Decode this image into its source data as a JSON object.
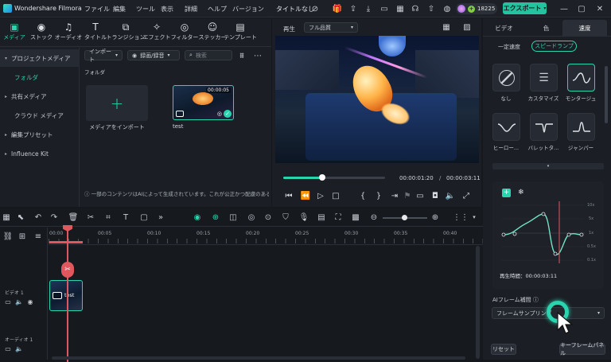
{
  "app": {
    "title": "Wondershare Filmora",
    "project_title": "タイトルなし",
    "credits": "18225",
    "export_label": "エクスポート"
  },
  "menu": [
    "ファイル",
    "編集",
    "ツール",
    "表示",
    "詳細",
    "ヘルプ",
    "バージョン"
  ],
  "toolbar_tabs": [
    {
      "label": "メディア",
      "icon": "media-icon"
    },
    {
      "label": "ストック",
      "icon": "stock-icon"
    },
    {
      "label": "オーディオ",
      "icon": "audio-icon"
    },
    {
      "label": "タイトル",
      "icon": "title-icon"
    },
    {
      "label": "トランジション",
      "icon": "transition-icon"
    },
    {
      "label": "エフェクト",
      "icon": "effect-icon"
    },
    {
      "label": "フィルター",
      "icon": "filter-icon"
    },
    {
      "label": "ステッカー",
      "icon": "sticker-icon"
    },
    {
      "label": "テンプレート",
      "icon": "template-icon"
    }
  ],
  "sidebar": {
    "items": [
      {
        "label": "プロジェクトメディア",
        "arrow": "▾"
      },
      {
        "label": "フォルダ",
        "arrow": ""
      },
      {
        "label": "共有メディア",
        "arrow": "▸"
      },
      {
        "label": "クラウド メディア",
        "arrow": ""
      },
      {
        "label": "編集プリセット",
        "arrow": "▸"
      },
      {
        "label": "Influence Kit",
        "arrow": "▸"
      }
    ]
  },
  "media": {
    "import_label": "インポート",
    "record_label": "録画/録音",
    "search_placeholder": "検索",
    "folder_label": "フォルダ",
    "import_tile_label": "メディアをインポート",
    "clip_name": "test",
    "clip_duration": "00:00:05",
    "notice": "一部のコンテンツはAIによって生成されています。これが公正かつ配慮のある..."
  },
  "player": {
    "tab_label": "再生",
    "quality": "フル品質",
    "current_time": "00:00:01:20",
    "total_time": "00:00:03:11",
    "progress": 0.38
  },
  "right_panel": {
    "tabs": [
      "ビデオ",
      "色",
      "速度"
    ],
    "sub_tabs": [
      "一定速度",
      "スピードランプ"
    ],
    "presets": [
      {
        "label": "なし"
      },
      {
        "label": "カスタマイズ"
      },
      {
        "label": "モンタージュ"
      },
      {
        "label": "ヒーロー..."
      },
      {
        "label": "バレットタ..."
      },
      {
        "label": "ジャンパー"
      }
    ],
    "graph_y_labels": [
      "10x",
      "5x",
      "1x",
      "0.5x",
      "0.1x"
    ],
    "duration_label": "再生時間：00:00:03:11",
    "ai_label": "AIフレーム補間",
    "ai_select": "フレームサンプリング",
    "reset_label": "リセット",
    "keyframe_label": "キーフレームパネル"
  },
  "timeline": {
    "ruler": [
      "00:00",
      "00:05",
      "00:10",
      "00:15",
      "00:20",
      "00:25",
      "00:30",
      "00:35",
      "00:40"
    ],
    "video_track": "ビデオ 1",
    "audio_track": "オーディオ 1",
    "clip_label": "test"
  }
}
